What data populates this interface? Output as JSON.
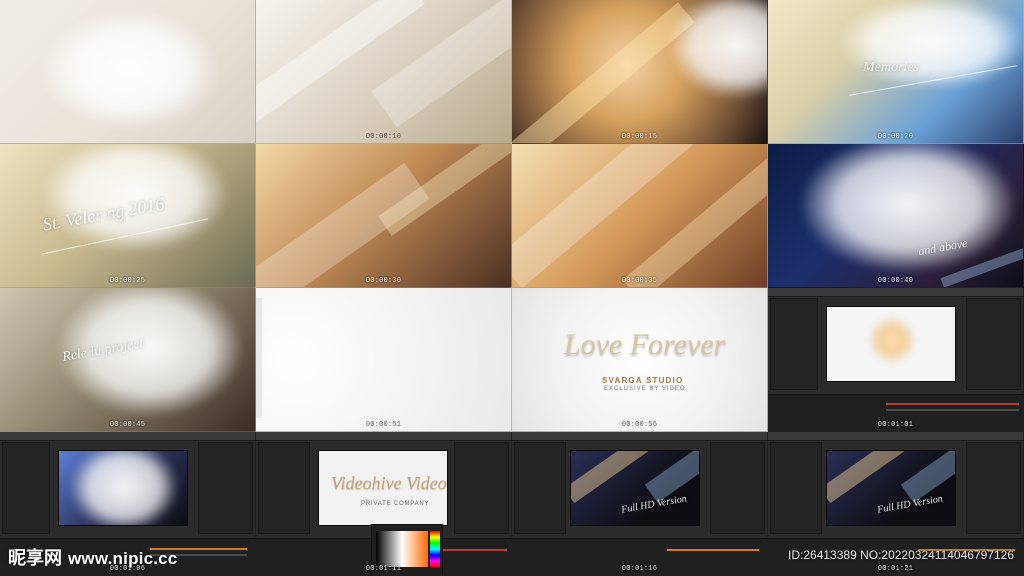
{
  "frames": [
    {
      "timestamp": "",
      "title": ""
    },
    {
      "timestamp": "00:00:10",
      "title": ""
    },
    {
      "timestamp": "00:00:15",
      "title": ""
    },
    {
      "timestamp": "00:00:20",
      "title": "Memories"
    },
    {
      "timestamp": "00:00:25",
      "title": "St. Veler ng 2016"
    },
    {
      "timestamp": "00:00:30",
      "title": ""
    },
    {
      "timestamp": "00:00:35",
      "title": ""
    },
    {
      "timestamp": "00:00:40",
      "title": "and above"
    },
    {
      "timestamp": "00:00:45",
      "title": "Rele lu project"
    },
    {
      "timestamp": "00:00:51",
      "title": ""
    },
    {
      "timestamp": "00:00:56",
      "title": "Love Forever",
      "brand": "SVARGA STUDIO",
      "subtitle": "EXCLUSIVE BY VIDEO"
    },
    {
      "timestamp": "00:01:01",
      "title": ""
    },
    {
      "timestamp": "00:01:06",
      "title": ""
    },
    {
      "timestamp": "00:01:11",
      "title": "Videohive Video",
      "subline": "PRIVATE COMPANY"
    },
    {
      "timestamp": "00:01:16",
      "title": "Full HD Version"
    },
    {
      "timestamp": "00:01:21",
      "title": "Full HD Version"
    }
  ],
  "watermark": {
    "logo_text": "昵享网",
    "url": "www.nipic.cc"
  },
  "id_line": "ID:26413389 NO:20220324114046797126",
  "colors": {
    "ui_bg": "#2b2b2b",
    "accent_red": "#c0392b",
    "accent_orange": "#f39c12",
    "accent_blue": "#2f6fd1"
  }
}
